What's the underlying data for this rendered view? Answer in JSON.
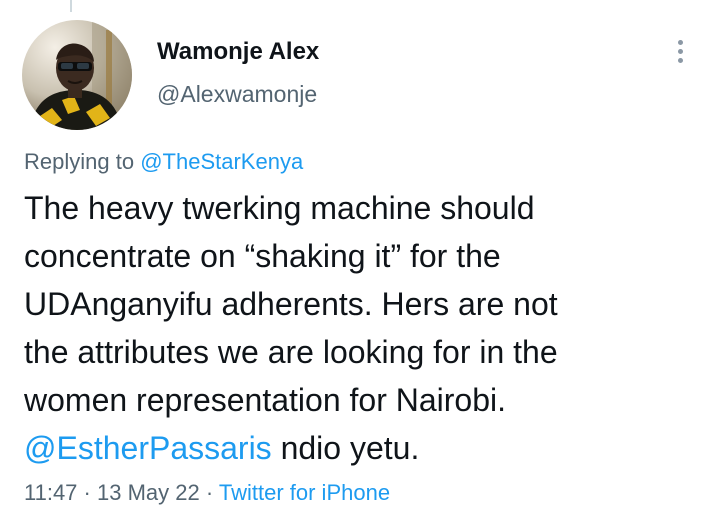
{
  "author": {
    "display_name": "Wamonje Alex",
    "handle": "@Alexwamonje",
    "avatar_icon": "profile-photo"
  },
  "more_icon": "more-vertical-icon",
  "reply_context": {
    "prefix": "Replying to",
    "mention": "@TheStarKenya"
  },
  "tweet": {
    "lines": [
      "The heavy twerking machine should",
      "concentrate on “shaking it” for the",
      "UDAnganyifu adherents. Hers are not",
      "the attributes we are looking for in the",
      "women representation for Nairobi."
    ],
    "last_line_mention": "@EstherPassaris",
    "last_line_text": " ndio yetu."
  },
  "meta": {
    "time": "11:47",
    "separator": " · ",
    "date": "13 May 22",
    "source": "Twitter for iPhone"
  },
  "colors": {
    "link": "#1d9bf0",
    "secondary_text": "#536471",
    "primary_text": "#0f1419",
    "background": "#ffffff"
  }
}
